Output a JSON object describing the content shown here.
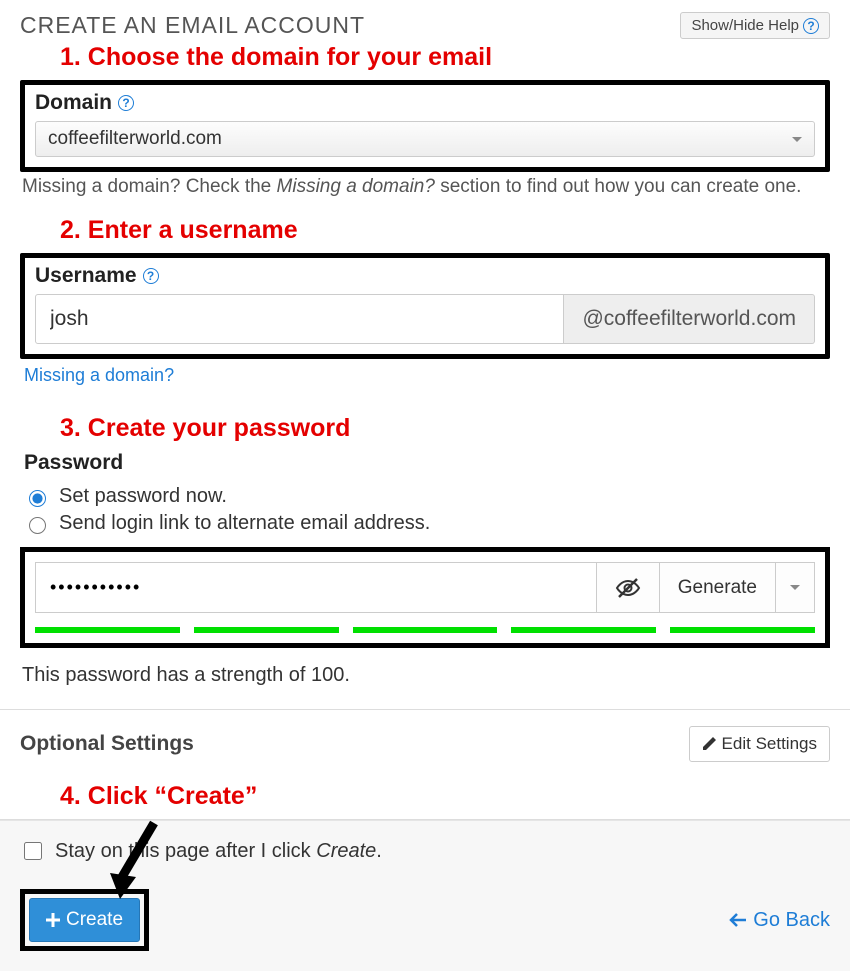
{
  "header": {
    "title": "CREATE AN EMAIL ACCOUNT",
    "help_label": "Show/Hide Help"
  },
  "annotations": {
    "step1": "1. Choose the domain for your email",
    "step2": "2. Enter a username",
    "step3": "3. Create your password",
    "step4": "4. Click “Create”"
  },
  "domain": {
    "label": "Domain",
    "value": "coffeefilterworld.com",
    "hint_prefix": "Missing a domain? Check the ",
    "hint_em": "Missing a domain?",
    "hint_suffix": " section to find out how you can create one."
  },
  "username": {
    "label": "Username",
    "value": "josh",
    "suffix": "@coffeefilterworld.com",
    "missing_link": "Missing a domain?"
  },
  "password": {
    "label": "Password",
    "radio_now": "Set password now.",
    "radio_alt": "Send login link to alternate email address.",
    "value": "•••••••••••",
    "generate": "Generate",
    "strength_text": "This password has a strength of 100."
  },
  "optional": {
    "heading": "Optional Settings",
    "edit_label": "Edit Settings"
  },
  "footer": {
    "stay_prefix": "Stay on this page after I click ",
    "stay_em": "Create",
    "stay_suffix": ".",
    "create": "Create",
    "goback": "Go Back"
  },
  "icons": {
    "pencil": "pencil-icon",
    "plus": "plus-icon",
    "eye_off": "eye-off-icon",
    "help": "help-icon",
    "arrow_left": "arrow-left-icon"
  }
}
